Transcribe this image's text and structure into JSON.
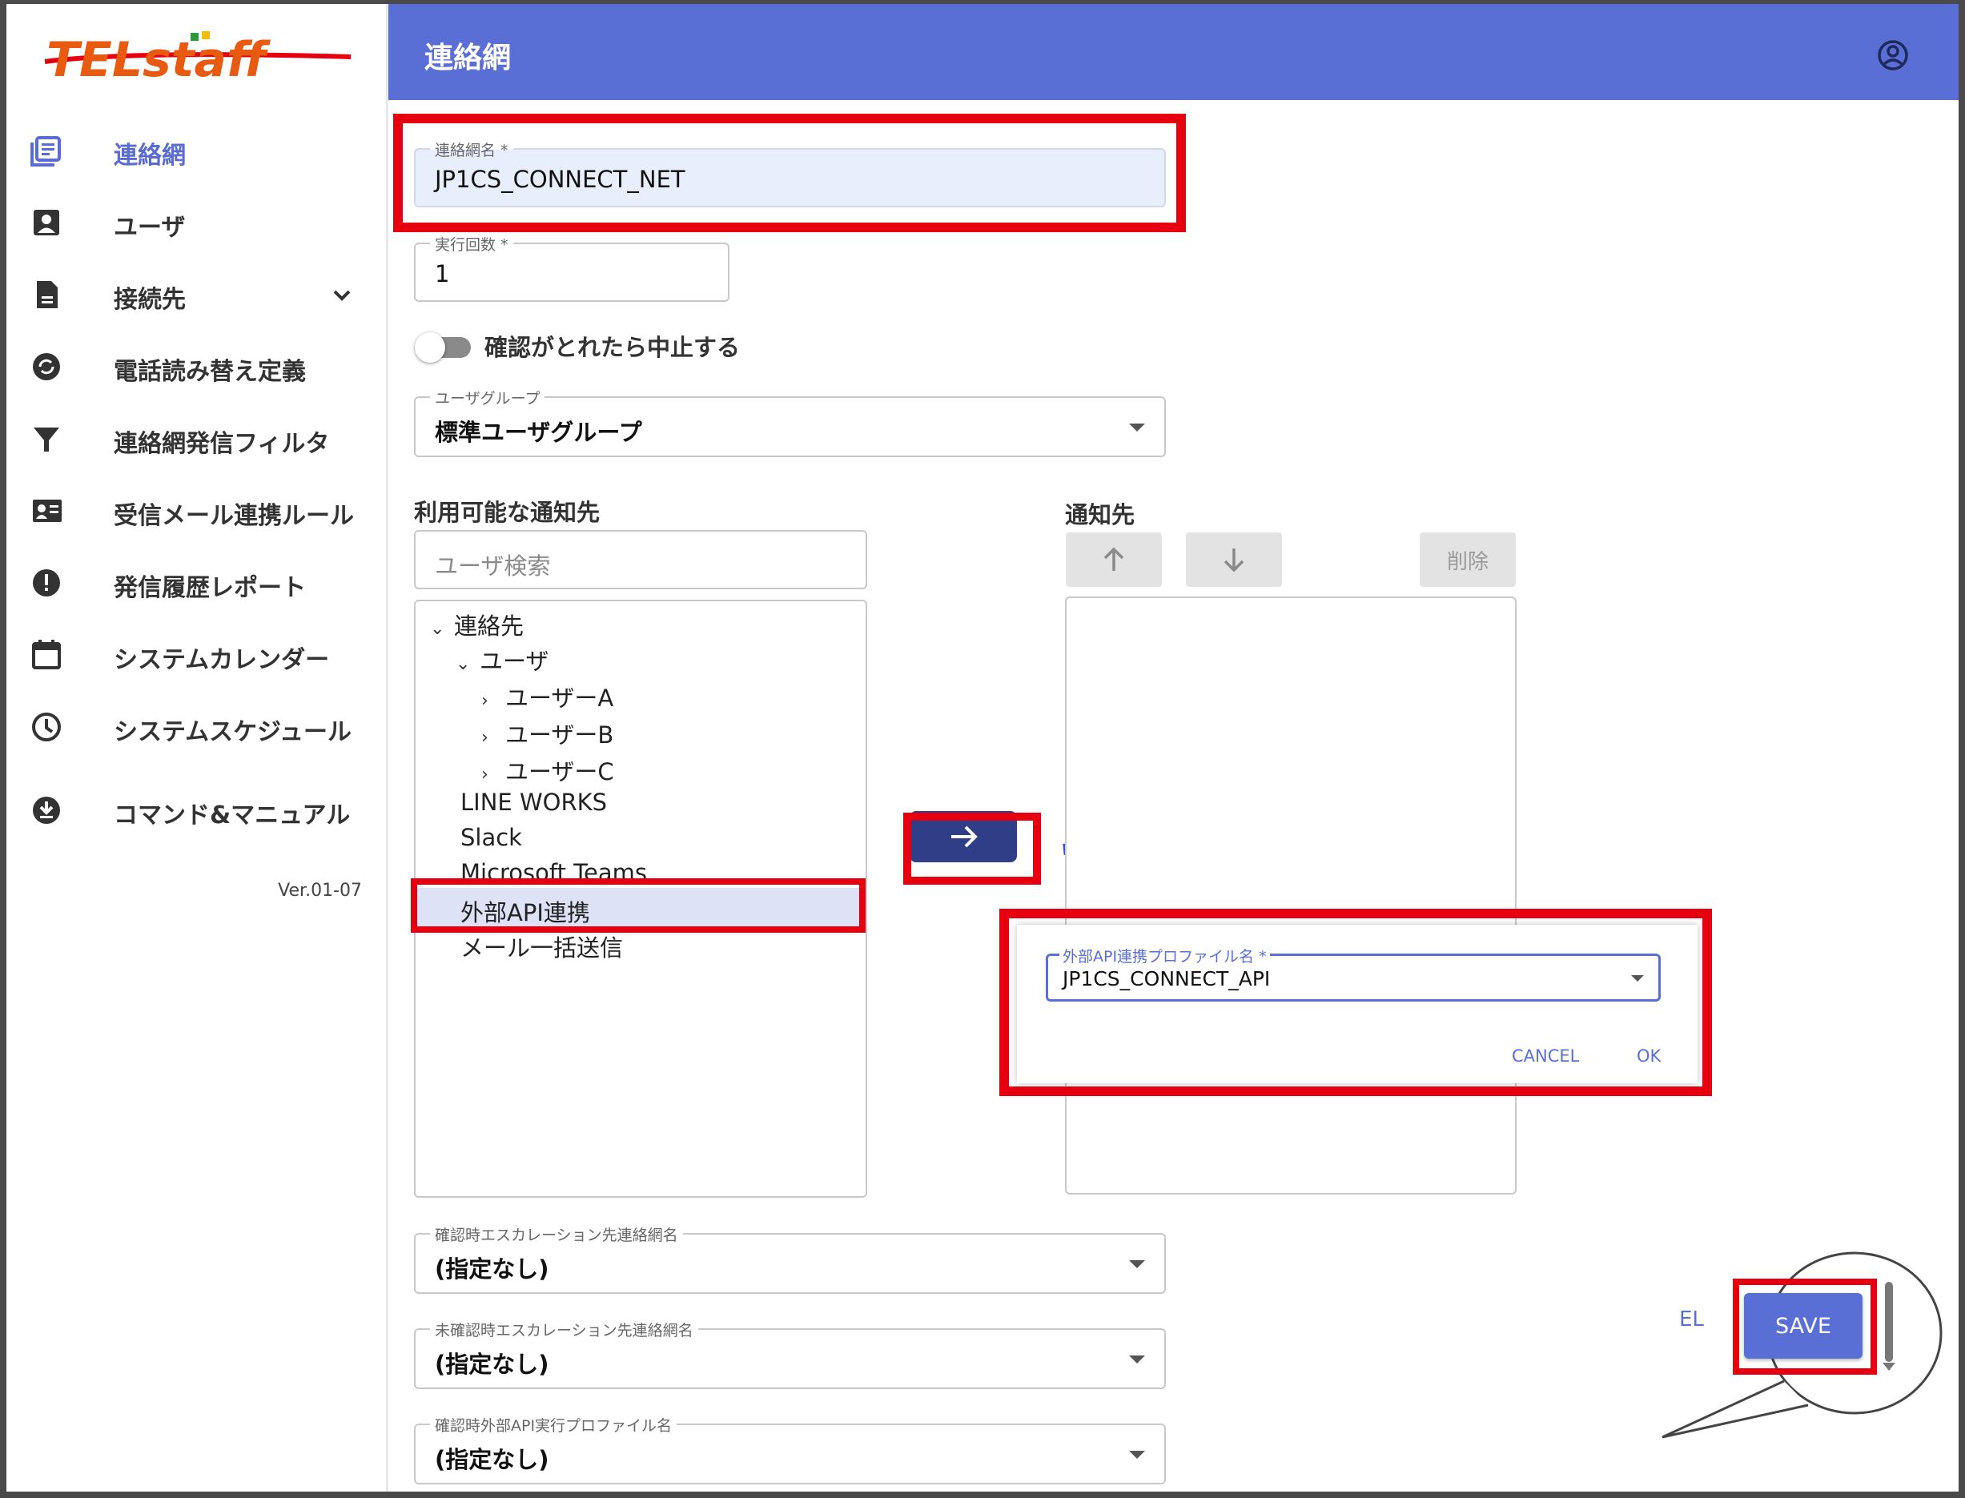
{
  "brand": {
    "logo_text": "TELstaff"
  },
  "header": {
    "title": "連絡網"
  },
  "sidebar": {
    "items": [
      {
        "label": "連絡網",
        "icon": "list-icon"
      },
      {
        "label": "ユーザ",
        "icon": "account-box-icon"
      },
      {
        "label": "接続先",
        "icon": "document-icon"
      },
      {
        "label": "電話読み替え定義",
        "icon": "refresh-icon"
      },
      {
        "label": "連絡網発信フィルタ",
        "icon": "filter-icon"
      },
      {
        "label": "受信メール連携ルール",
        "icon": "contact-card-icon"
      },
      {
        "label": "発信履歴レポート",
        "icon": "alert-icon"
      },
      {
        "label": "システムカレンダー",
        "icon": "calendar-icon"
      },
      {
        "label": "システムスケジュール",
        "icon": "clock-icon"
      },
      {
        "label": "コマンド&マニュアル",
        "icon": "download-icon"
      }
    ],
    "version": "Ver.01-07"
  },
  "form": {
    "name": {
      "label": "連絡網名 *",
      "value": "JP1CS_CONNECT_NET"
    },
    "runs": {
      "label": "実行回数 *",
      "value": "1"
    },
    "stop_toggle": {
      "label": "確認がとれたら中止する",
      "on": false
    },
    "user_group": {
      "label": "ユーザグループ",
      "value": "標準ユーザグループ"
    },
    "available": {
      "title": "利用可能な通知先",
      "search_placeholder": "ユーザ検索",
      "tree": {
        "root": "連絡先",
        "users": "ユーザ",
        "user_a": "ユーザーA",
        "user_b": "ユーザーB",
        "user_c": "ユーザーC",
        "line": "LINE WORKS",
        "slack": "Slack",
        "teams": "Microsoft Teams",
        "api": "外部API連携",
        "mail": "メール一括送信"
      }
    },
    "targets": {
      "title": "通知先",
      "delete_label": "削除"
    },
    "esc_confirmed": {
      "label": "確認時エスカレーション先連絡網名",
      "value": "(指定なし)"
    },
    "esc_unconfirmed": {
      "label": "未確認時エスカレーション先連絡網名",
      "value": "(指定なし)"
    },
    "api_profile": {
      "label": "確認時外部API実行プロファイル名",
      "value": "(指定なし)"
    }
  },
  "dialog": {
    "label": "外部API連携プロファイル名 *",
    "value": "JP1CS_CONNECT_API",
    "cancel": "CANCEL",
    "ok": "OK"
  },
  "callout": {
    "cancel_fragment": "EL",
    "save": "SAVE"
  },
  "colors": {
    "accent": "#5a6fd6",
    "highlight": "#e6000f",
    "arrow_button": "#2f3e86"
  }
}
